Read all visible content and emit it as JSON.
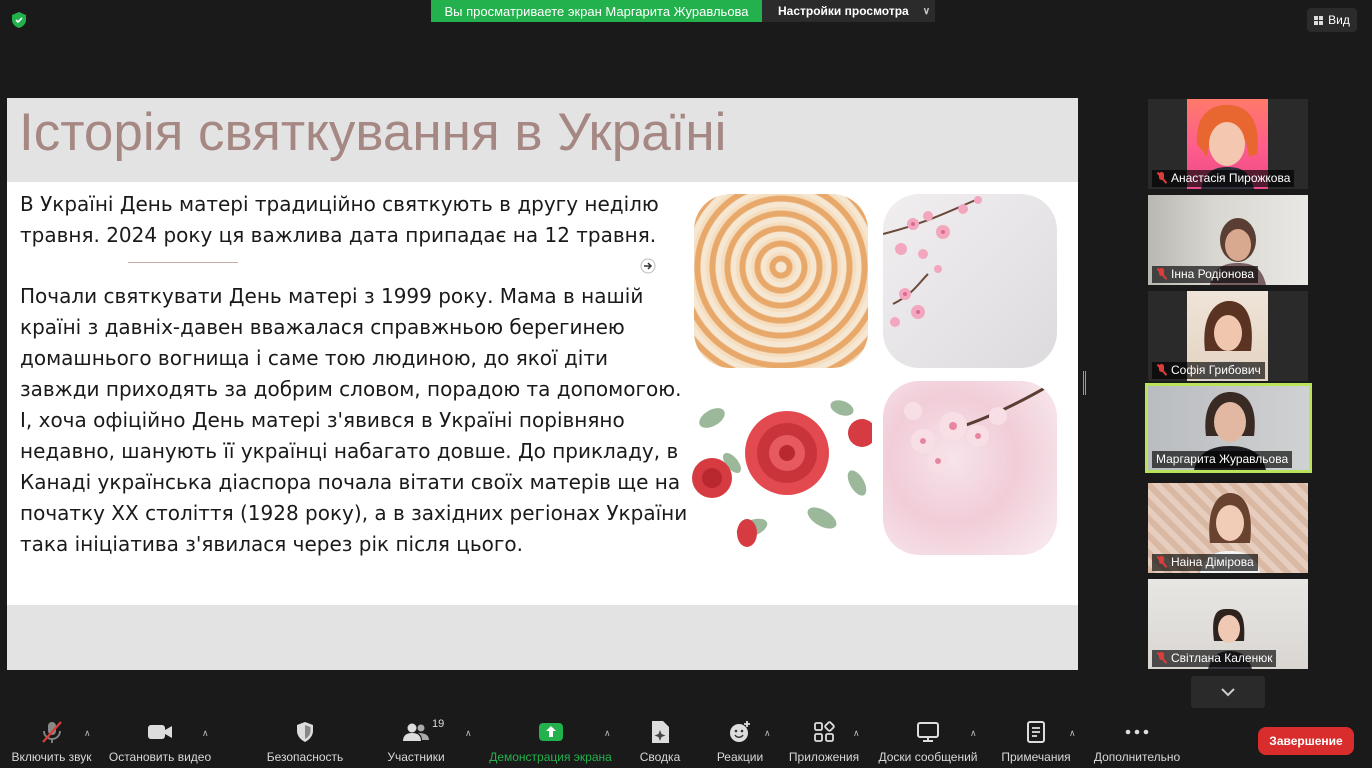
{
  "meeting": {
    "share_banner": "Вы просматриваете экран Маргарита Журавльова",
    "view_settings": "Настройки просмотра",
    "view_button": "Вид"
  },
  "slide": {
    "title": "Історія святкування в Україні",
    "para1": "В Україні День матері традиційно святкують в другу неділю травня. 2024 року ця важлива дата припадає на 12 травня.",
    "para2": "Почали святкувати День матері з 1999 року. Мама в нашій країні з давніх-давен вважалася справжньою берегинею домашнього вогнища і саме тою людиною, до якої діти завжди приходять за добрим словом, порадою та допомогою. І, хоча офіційно День матері з'явився в Україні порівняно недавно, шанують її українці набагато довше. До прикладу, в Канаді українська діаспора почала вітати своїх матерів ще на початку XX століття (1928 року), а в західних регіонах України така ініціатива з'явилася через рік після цього."
  },
  "participants": [
    {
      "name": "Анастасія Пирожкова",
      "muted": true,
      "active": false
    },
    {
      "name": "Інна Родіонова",
      "muted": true,
      "active": false
    },
    {
      "name": "Софія Грибович",
      "muted": true,
      "active": false
    },
    {
      "name": "Маргарита Журавльова",
      "muted": false,
      "active": true
    },
    {
      "name": "Наіна Дімірова",
      "muted": true,
      "active": false
    },
    {
      "name": "Світлана Каленюк",
      "muted": true,
      "active": false
    }
  ],
  "toolbar": {
    "unmute": "Включить звук",
    "stop_video": "Остановить видео",
    "security": "Безопасность",
    "participants": "Участники",
    "participants_count": "19",
    "share_screen": "Демонстрация экрана",
    "summary": "Сводка",
    "reactions": "Реакции",
    "apps": "Приложения",
    "whiteboards": "Доски сообщений",
    "notes": "Примечания",
    "more": "Дополнительно",
    "end": "Завершение"
  },
  "colors": {
    "share_green": "#22b14c",
    "active_speaker_border": "#b9e35b",
    "end_red": "#d92c2c",
    "title_color": "#a58783"
  }
}
